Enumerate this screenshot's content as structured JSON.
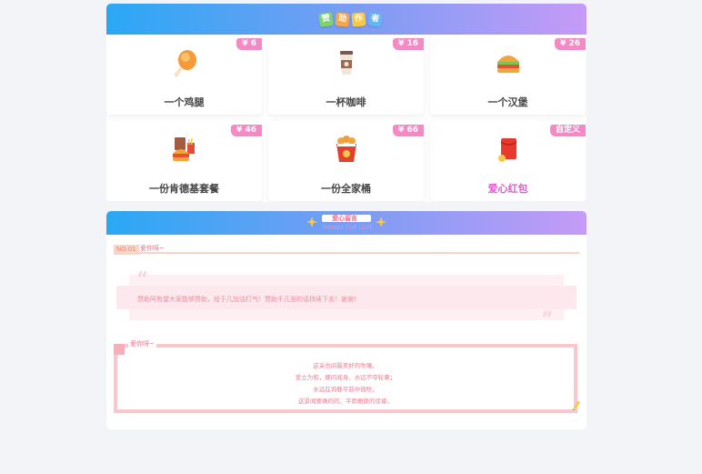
{
  "gifts": {
    "header_blocks": [
      "赞",
      "助",
      "作",
      "者"
    ],
    "items": [
      {
        "name": "一个鸡腿",
        "price": "¥ 6",
        "icon": "chicken-leg-icon"
      },
      {
        "name": "一杯咖啡",
        "price": "¥ 16",
        "icon": "coffee-cup-icon"
      },
      {
        "name": "一个汉堡",
        "price": "¥ 26",
        "icon": "hamburger-icon"
      },
      {
        "name": "一份肯德基套餐",
        "price": "¥ 46",
        "icon": "kfc-combo-icon"
      },
      {
        "name": "一份全家桶",
        "price": "¥ 66",
        "icon": "family-bucket-icon"
      },
      {
        "name": "爱心红包",
        "price": "自定义",
        "icon": "red-envelope-icon"
      }
    ]
  },
  "thanks": {
    "title": "爱心留言",
    "subtitle": "THANKS FOR LOVE",
    "no_badge": "NO.01",
    "section1_label": "爱你呀~",
    "quote": "赞助阿有望大家能够赞助，给于几加油打气！赞助千几张的话持续下去！谢谢!",
    "section2_label": "爱你呀~",
    "poem": [
      "这采也间最美好的吹嘴，",
      "爱立为和，娜问闻身、水远不夺轮裹；",
      "水远在询静平前中微吹，",
      "这景闻要确的的、平雨概撕的徐睿。"
    ]
  },
  "colors": {
    "price_tag": "#f489c6",
    "accent_pink": "#e15ad2",
    "gradient_start": "#2aa8f4",
    "gradient_end": "#c59bf7"
  }
}
